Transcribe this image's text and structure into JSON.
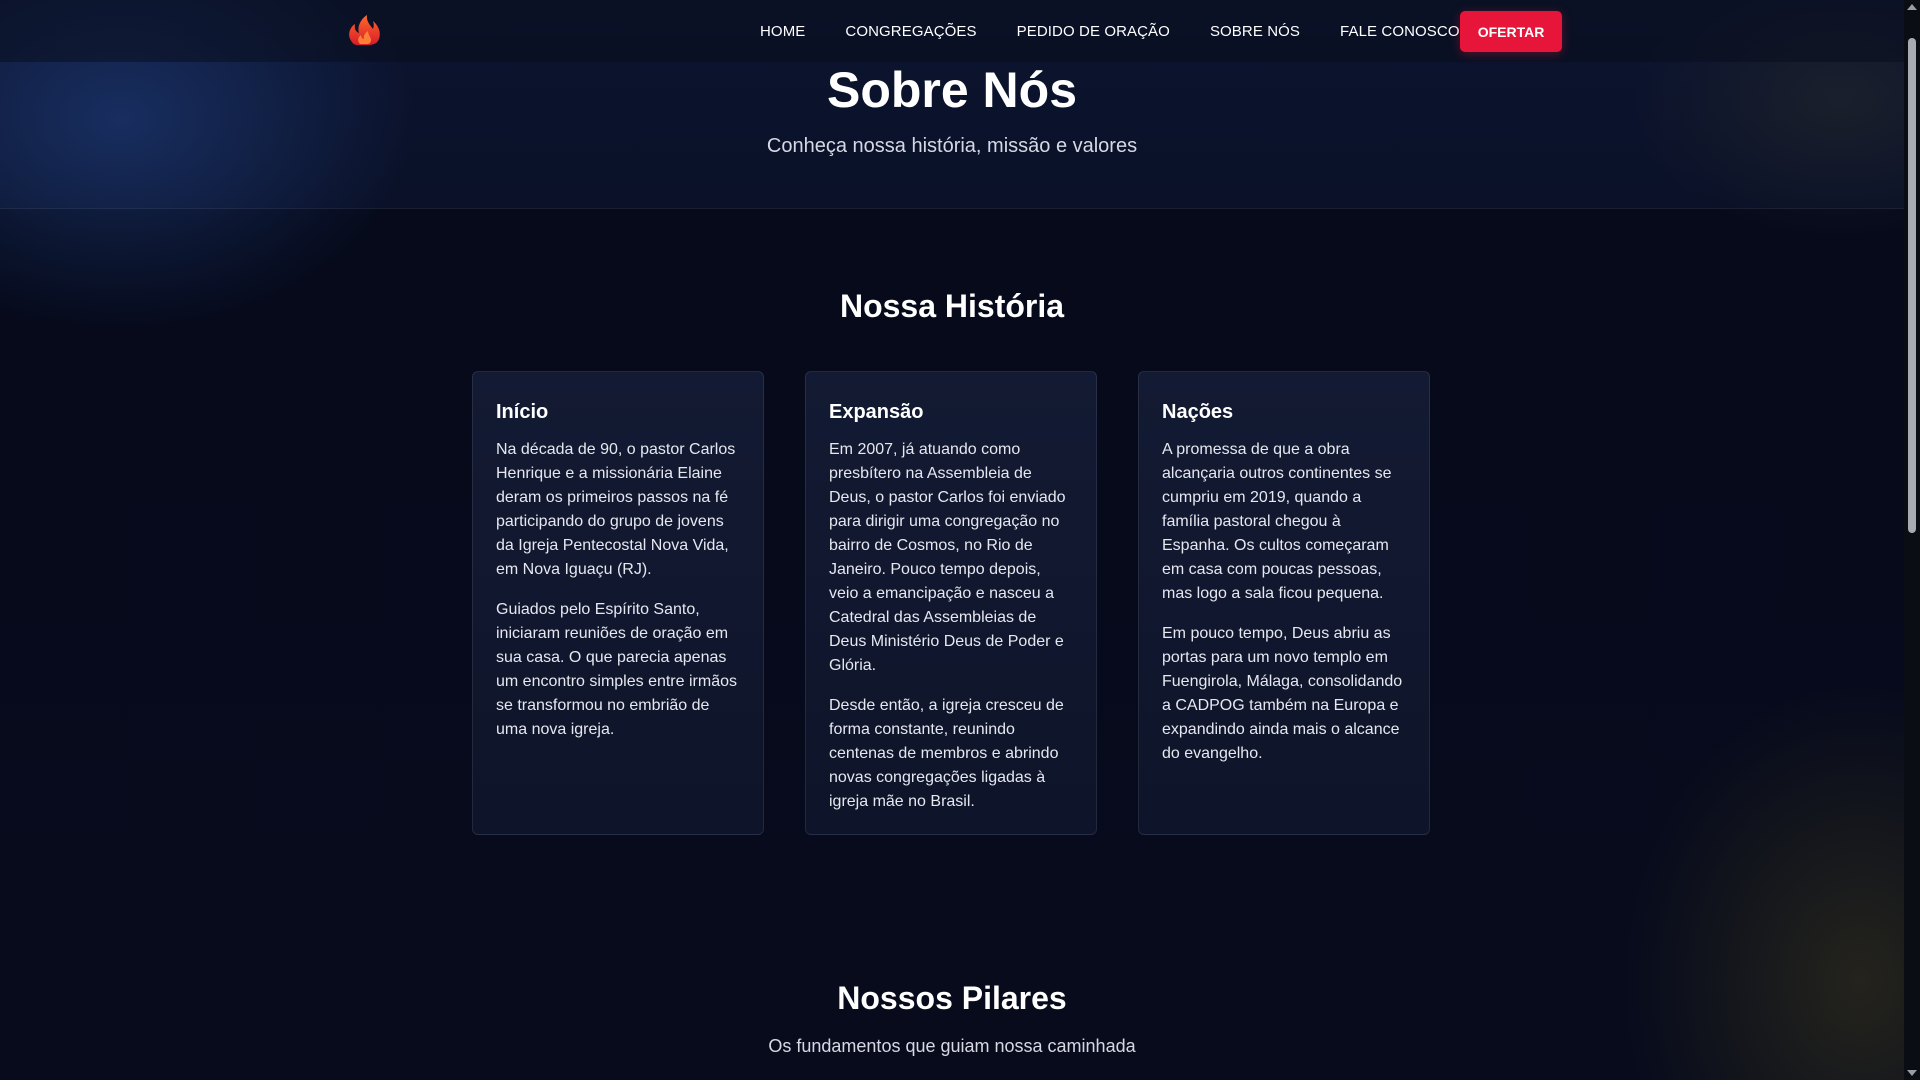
{
  "nav": {
    "logo_icon": "flame-icon",
    "links": [
      "HOME",
      "CONGREGAÇÕES",
      "PEDIDO DE ORAÇÃO",
      "SOBRE NÓS",
      "FALE CONOSCO"
    ],
    "cta_label": "OFERTAR"
  },
  "hero": {
    "title": "Sobre Nós",
    "subtitle": "Conheça nossa história, missão e valores"
  },
  "history": {
    "title": "Nossa História",
    "cards": [
      {
        "title": "Início",
        "paragraphs": [
          "Na década de 90, o pastor Carlos Henrique e a missionária Elaine deram os primeiros passos na fé participando do grupo de jovens da Igreja Pentecostal Nova Vida, em Nova Iguaçu (RJ).",
          "Guiados pelo Espírito Santo, iniciaram reuniões de oração em sua casa. O que parecia apenas um encontro simples entre irmãos se transformou no embrião de uma nova igreja."
        ]
      },
      {
        "title": "Expansão",
        "paragraphs": [
          "Em 2007, já atuando como presbítero na Assembleia de Deus, o pastor Carlos foi enviado para dirigir uma congregação no bairro de Cosmos, no Rio de Janeiro. Pouco tempo depois, veio a emancipação e nasceu a Catedral das Assembleias de Deus Ministério Deus de Poder e Glória.",
          "Desde então, a igreja cresceu de forma constante, reunindo centenas de membros e abrindo novas congregações ligadas à igreja mãe no Brasil."
        ]
      },
      {
        "title": "Nações",
        "paragraphs": [
          "A promessa de que a obra alcançaria outros continentes se cumpriu em 2019, quando a família pastoral chegou à Espanha. Os cultos começaram em casa com poucas pessoas, mas logo a sala ficou pequena.",
          "Em pouco tempo, Deus abriu as portas para um novo templo em Fuengirola, Málaga, consolidando a CADPOG também na Europa e expandindo ainda mais o alcance do evangelho."
        ]
      }
    ]
  },
  "pillars": {
    "title": "Nossos Pilares",
    "subtitle": "Os fundamentos que guiam nossa caminhada"
  },
  "colors": {
    "accent": "#e8153a",
    "background": "#070b1c",
    "card": "#131a33"
  }
}
